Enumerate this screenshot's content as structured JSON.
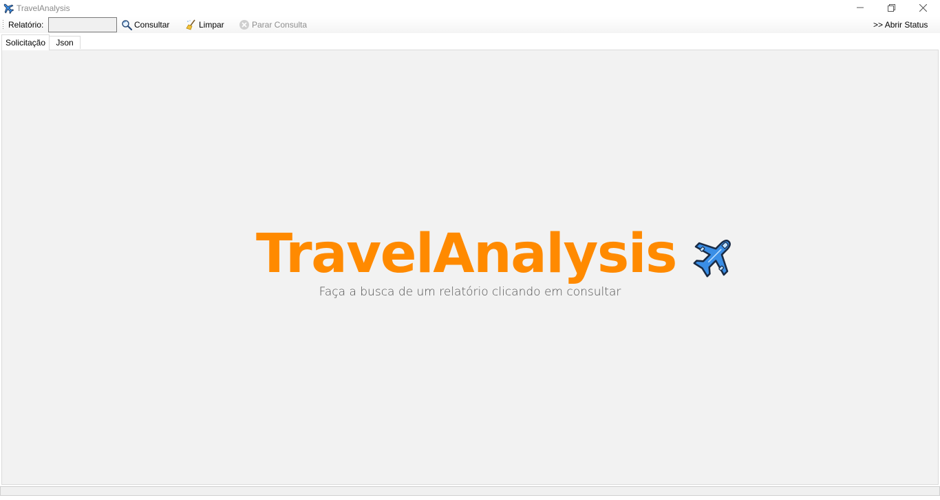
{
  "window": {
    "title": "TravelAnalysis",
    "app_icon": "airplane-icon",
    "controls": [
      "minimize-icon",
      "restore-icon",
      "close-icon"
    ]
  },
  "toolbar": {
    "report_label": "Relatório:",
    "report_value": "",
    "consultar_label": "Consultar",
    "consultar_icon": "magnifier-icon",
    "limpar_label": "Limpar",
    "limpar_icon": "broom-icon",
    "parar_label": "Parar Consulta",
    "parar_icon": "stop-circle-icon",
    "parar_enabled": false,
    "status_label": ">> Abrir Status"
  },
  "tabs": [
    {
      "label": "Solicitação",
      "active": true
    },
    {
      "label": "Json",
      "active": false
    }
  ],
  "main": {
    "brand_title": "TravelAnalysis",
    "brand_icon": "airplane-icon",
    "subtitle": "Faça a busca de um relatório clicando em consultar"
  },
  "colors": {
    "brand_orange": "#ff8a00",
    "panel_bg": "#f2f2f2",
    "plane_blue": "#3a8ee6"
  }
}
